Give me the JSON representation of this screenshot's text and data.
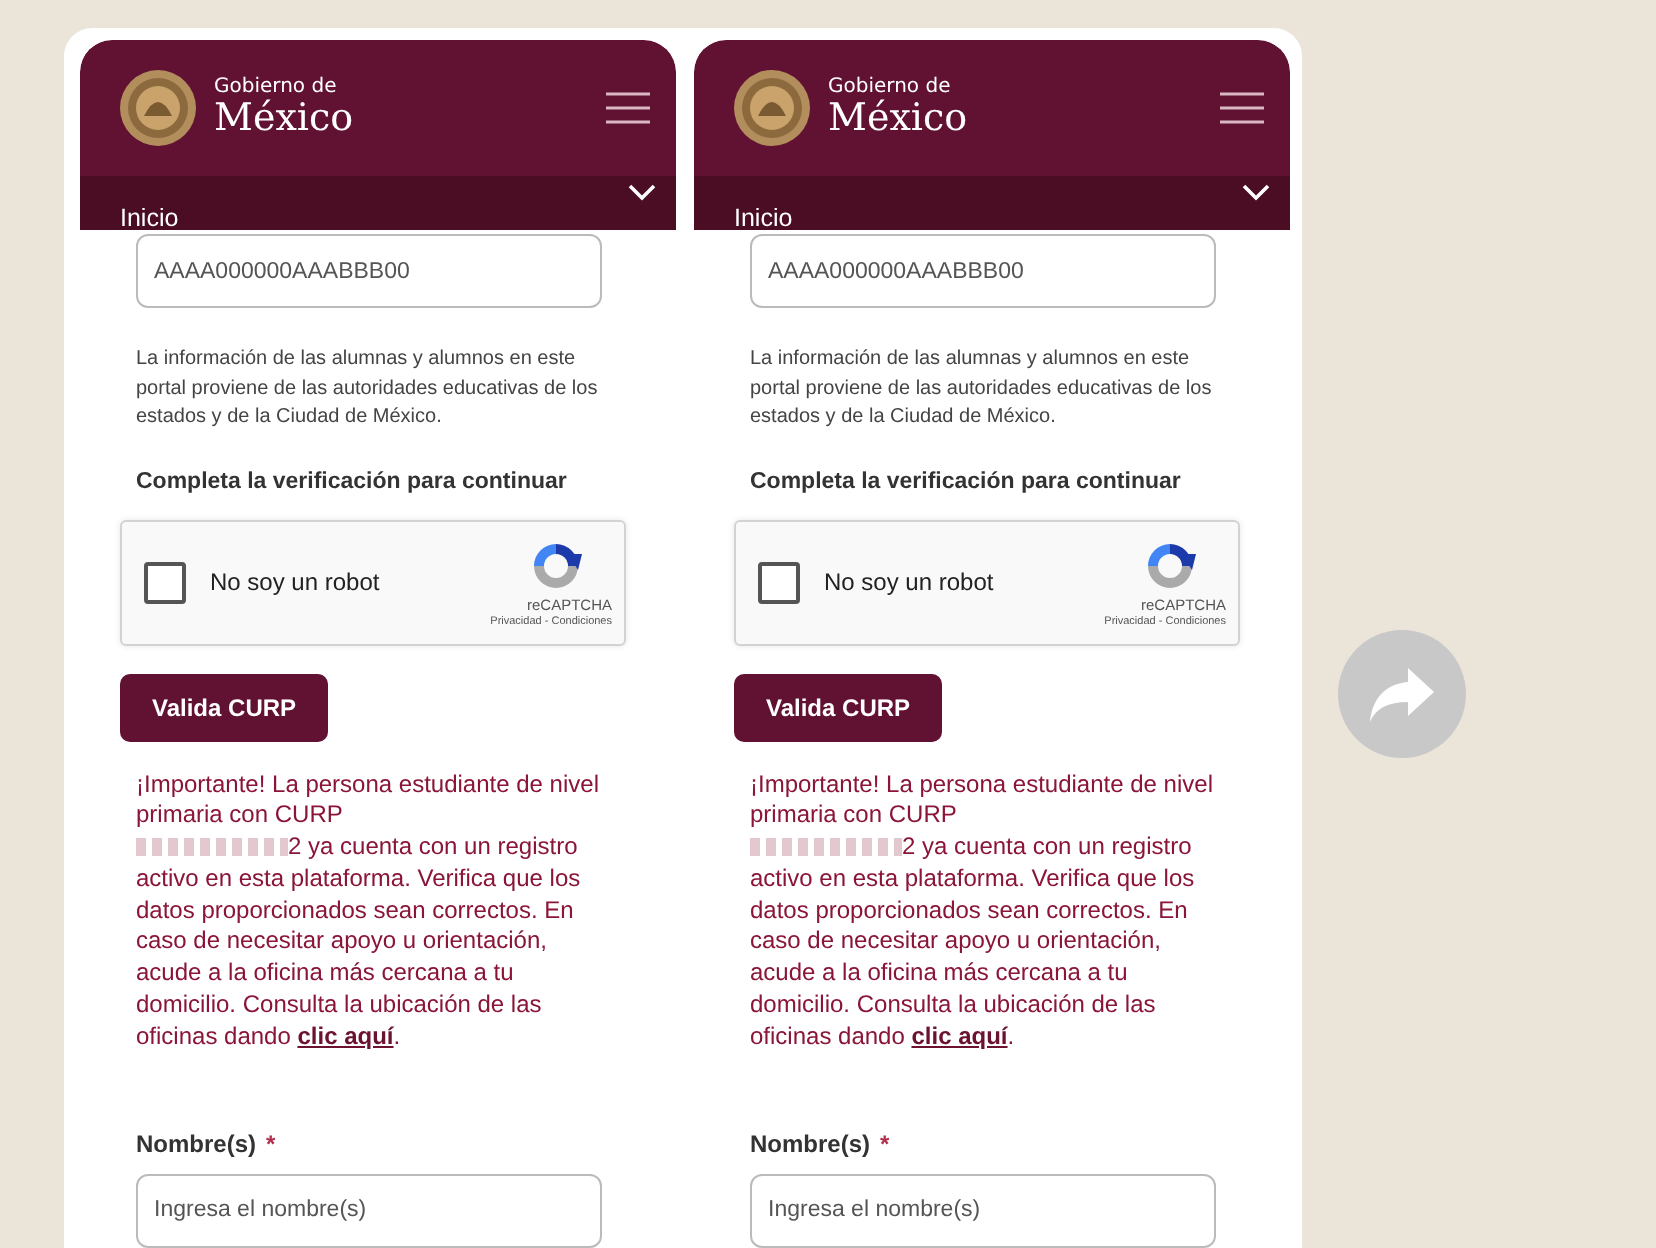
{
  "screens": [
    {
      "header": {
        "logo_top": "Gobierno de",
        "logo_bottom": "México",
        "nav_label": "Inicio"
      },
      "curp_field": {
        "placeholder": "AAAA000000AAABBB00"
      },
      "info_text": "La información de las alumnas y alumnos en este portal proviene de las autoridades educativas de los estados y de la Ciudad de México.",
      "verification_heading": "Completa la verificación para continuar",
      "captcha": {
        "label": "No soy un robot",
        "checked": false,
        "brand": "reCAPTCHA",
        "links": "Privacidad - Condiciones"
      },
      "submit_button": "Valida CURP",
      "notice": {
        "before": "¡Importante! La persona estudiante de nivel primaria con CURP",
        "after": "2 ya cuenta con un registro activo en esta plataforma. Verifica que los datos proporcionados sean correctos. En caso de necesitar apoyo u orientación, acude a la oficina más cercana a tu domicilio. Consulta la ubicación de las oficinas dando",
        "link": "clic aquí",
        "end": "."
      },
      "name_field": {
        "label": "Nombre(s)",
        "required_mark": "*",
        "placeholder": "Ingresa el nombre(s)"
      }
    },
    {
      "header": {
        "logo_top": "Gobierno de",
        "logo_bottom": "México",
        "nav_label": "Inicio"
      },
      "curp_field": {
        "placeholder": "AAAA000000AAABBB00"
      },
      "info_text": "La información de las alumnas y alumnos en este portal proviene de las autoridades educativas de los estados y de la Ciudad de México.",
      "verification_heading": "Completa la verificación para continuar",
      "captcha": {
        "label": "No soy un robot",
        "checked": false,
        "brand": "reCAPTCHA",
        "links": "Privacidad - Condiciones"
      },
      "submit_button": "Valida CURP",
      "notice": {
        "before": "¡Importante! La persona estudiante de nivel primaria con CURP",
        "after": "2 ya cuenta con un registro activo en esta plataforma. Verifica que los datos proporcionados sean correctos. En caso de necesitar apoyo u orientación, acude a la oficina más cercana a tu domicilio. Consulta la ubicación de las oficinas dando",
        "link": "clic aquí",
        "end": "."
      },
      "name_field": {
        "label": "Nombre(s)",
        "required_mark": "*",
        "placeholder": "Ingresa el nombre(s)"
      }
    }
  ]
}
